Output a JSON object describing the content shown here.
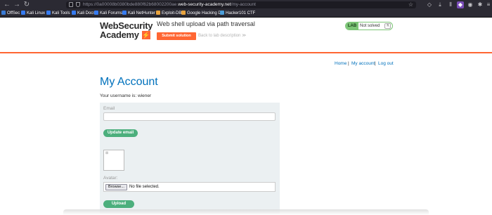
{
  "browser": {
    "url_dim": "https://0a00008b0380bde880f62b68002200ae.",
    "url_host": "web-security-academy.net",
    "url_path": "/my-account"
  },
  "bookmarks": [
    {
      "label": "OffSec",
      "color": "#3a7bd5"
    },
    {
      "label": "Kali Linux",
      "color": "#367bf0"
    },
    {
      "label": "Kali Tools",
      "color": "#367bf0"
    },
    {
      "label": "Kali Docs",
      "color": "#367bf0"
    },
    {
      "label": "Kali Forums",
      "color": "#367bf0"
    },
    {
      "label": "Kali NetHunter",
      "color": "#367bf0"
    },
    {
      "label": "Exploit-DB",
      "color": "#e8a33d"
    },
    {
      "label": "Google Hacking DB",
      "color": "#e8a33d"
    },
    {
      "label": "Hacker101 CTF",
      "color": "#4c9ed9"
    }
  ],
  "header": {
    "logo_line1": "WebSecurity",
    "logo_line2": "Academy",
    "logo_mark": "⚡",
    "lab_title": "Web shell upload via path traversal",
    "submit_label": "Submit solution",
    "back_label": "Back to lab description",
    "back_arrow": "≫",
    "badge_lab": "LAB",
    "badge_status": "Not solved"
  },
  "nav": {
    "home": "Home",
    "sep": "|",
    "my_account": "My account",
    "log_out": "Log out"
  },
  "page": {
    "title": "My Account",
    "username_text": "Your username is: wiener"
  },
  "form": {
    "email_label": "Email",
    "email_value": "",
    "update_email_label": "Update email",
    "avatar_label": "Avatar:",
    "browse_label": "Browse...",
    "no_file_label": "No file selected.",
    "upload_label": "Upload"
  },
  "colors": {
    "accent_orange": "#ff6633",
    "link_blue": "#0071bc",
    "button_green": "#4caf7d",
    "badge_green": "#7cc576"
  }
}
